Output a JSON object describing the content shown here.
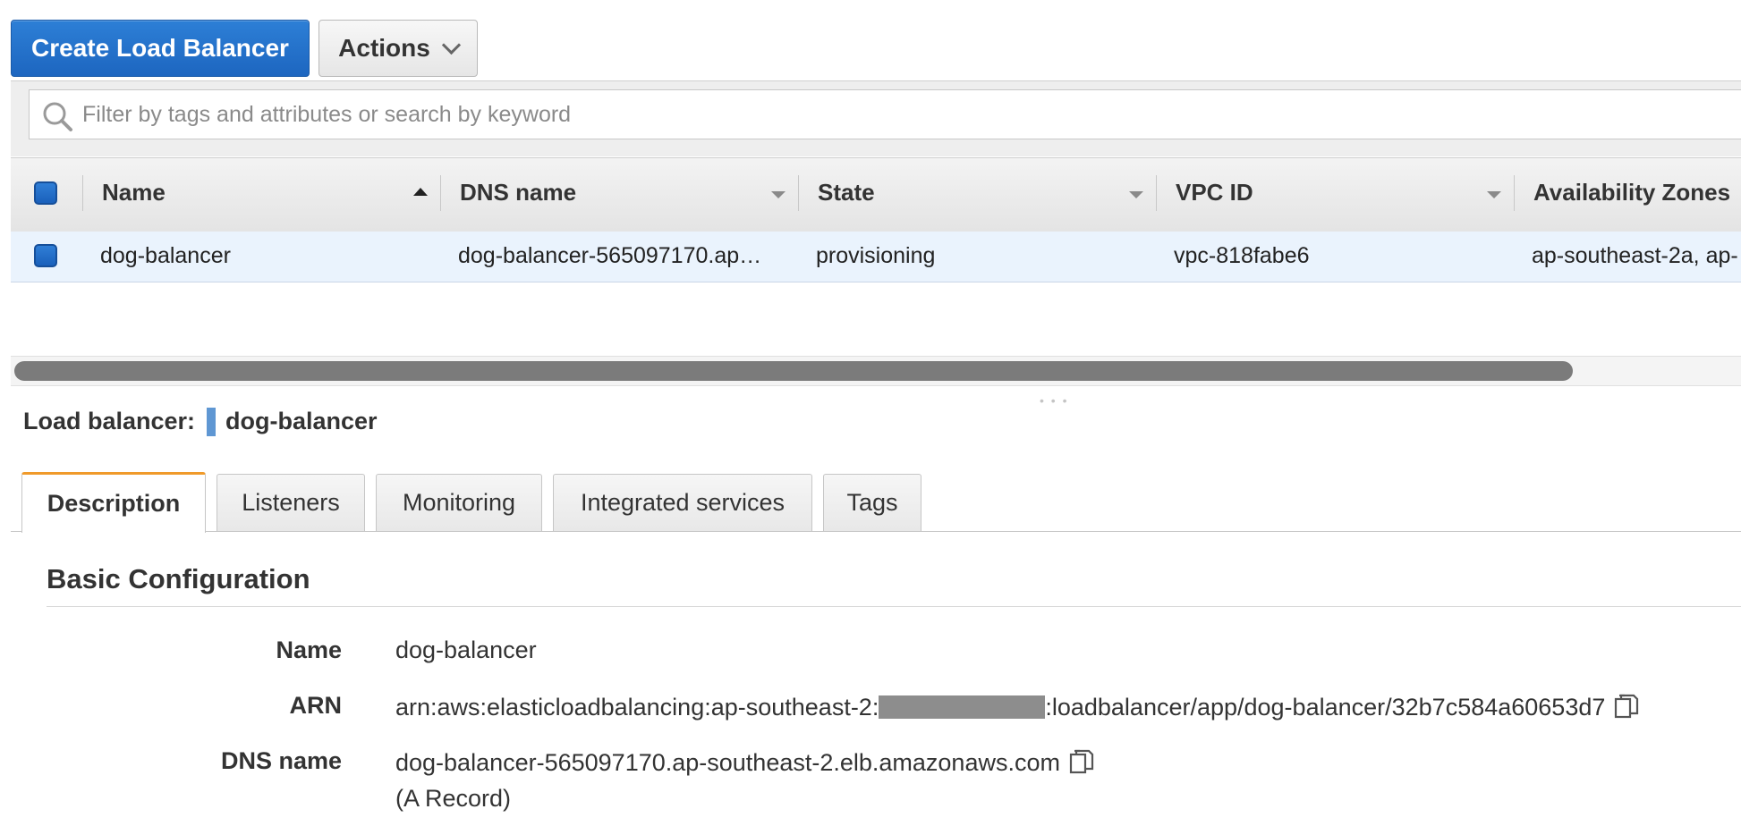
{
  "toolbar": {
    "create_label": "Create Load Balancer",
    "actions_label": "Actions"
  },
  "filter": {
    "placeholder": "Filter by tags and attributes or search by keyword"
  },
  "table": {
    "columns": [
      "Name",
      "DNS name",
      "State",
      "VPC ID",
      "Availability Zones"
    ],
    "rows": [
      {
        "name": "dog-balancer",
        "dns": "dog-balancer-565097170.ap…",
        "state": "provisioning",
        "vpc": "vpc-818fabe6",
        "az": "ap-southeast-2a, ap-"
      }
    ]
  },
  "detail": {
    "label": "Load balancer:",
    "name": "dog-balancer",
    "tabs": [
      "Description",
      "Listeners",
      "Monitoring",
      "Integrated services",
      "Tags"
    ],
    "active_tab": "Description",
    "section_title": "Basic Configuration",
    "fields": {
      "name_label": "Name",
      "name_value": "dog-balancer",
      "arn_label": "ARN",
      "arn_prefix": "arn:aws:elasticloadbalancing:ap-southeast-2:",
      "arn_suffix": ":loadbalancer/app/dog-balancer/32b7c584a60653d7",
      "dns_label": "DNS name",
      "dns_value": "dog-balancer-565097170.ap-southeast-2.elb.amazonaws.com",
      "dns_note": "(A Record)"
    }
  },
  "colors": {
    "primary": "#1d66c0",
    "row_selected": "#eaf3fd",
    "active_tab_accent": "#f09a2a"
  }
}
